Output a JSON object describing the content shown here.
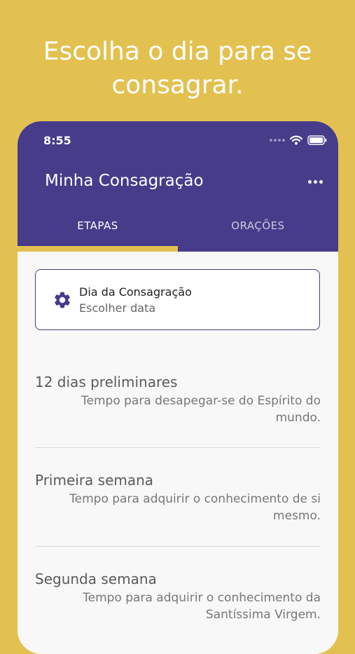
{
  "headline": {
    "line1": "Escolha o dia para se",
    "line2": "consagrar."
  },
  "status_bar": {
    "time": "8:55"
  },
  "app_bar": {
    "title": "Minha Consagração",
    "more_icon": "more-horizontal-icon",
    "background": "#463C8A"
  },
  "tabs": [
    {
      "label": "ETAPAS",
      "selected": true
    },
    {
      "label": "ORAÇÕES",
      "selected": false
    }
  ],
  "accent_color": "#E3C151",
  "consecration_card": {
    "icon": "gear-icon",
    "title": "Dia da Consagração",
    "subtitle": "Escolher data"
  },
  "steps": [
    {
      "title": "12 dias preliminares",
      "description": "Tempo para desapegar-se do Espírito do mundo."
    },
    {
      "title": "Primeira semana",
      "description": "Tempo para adquirir o conhecimento de si mesmo."
    },
    {
      "title": "Segunda semana",
      "description": "Tempo para adquirir o conhecimento da Santíssima Virgem."
    }
  ]
}
